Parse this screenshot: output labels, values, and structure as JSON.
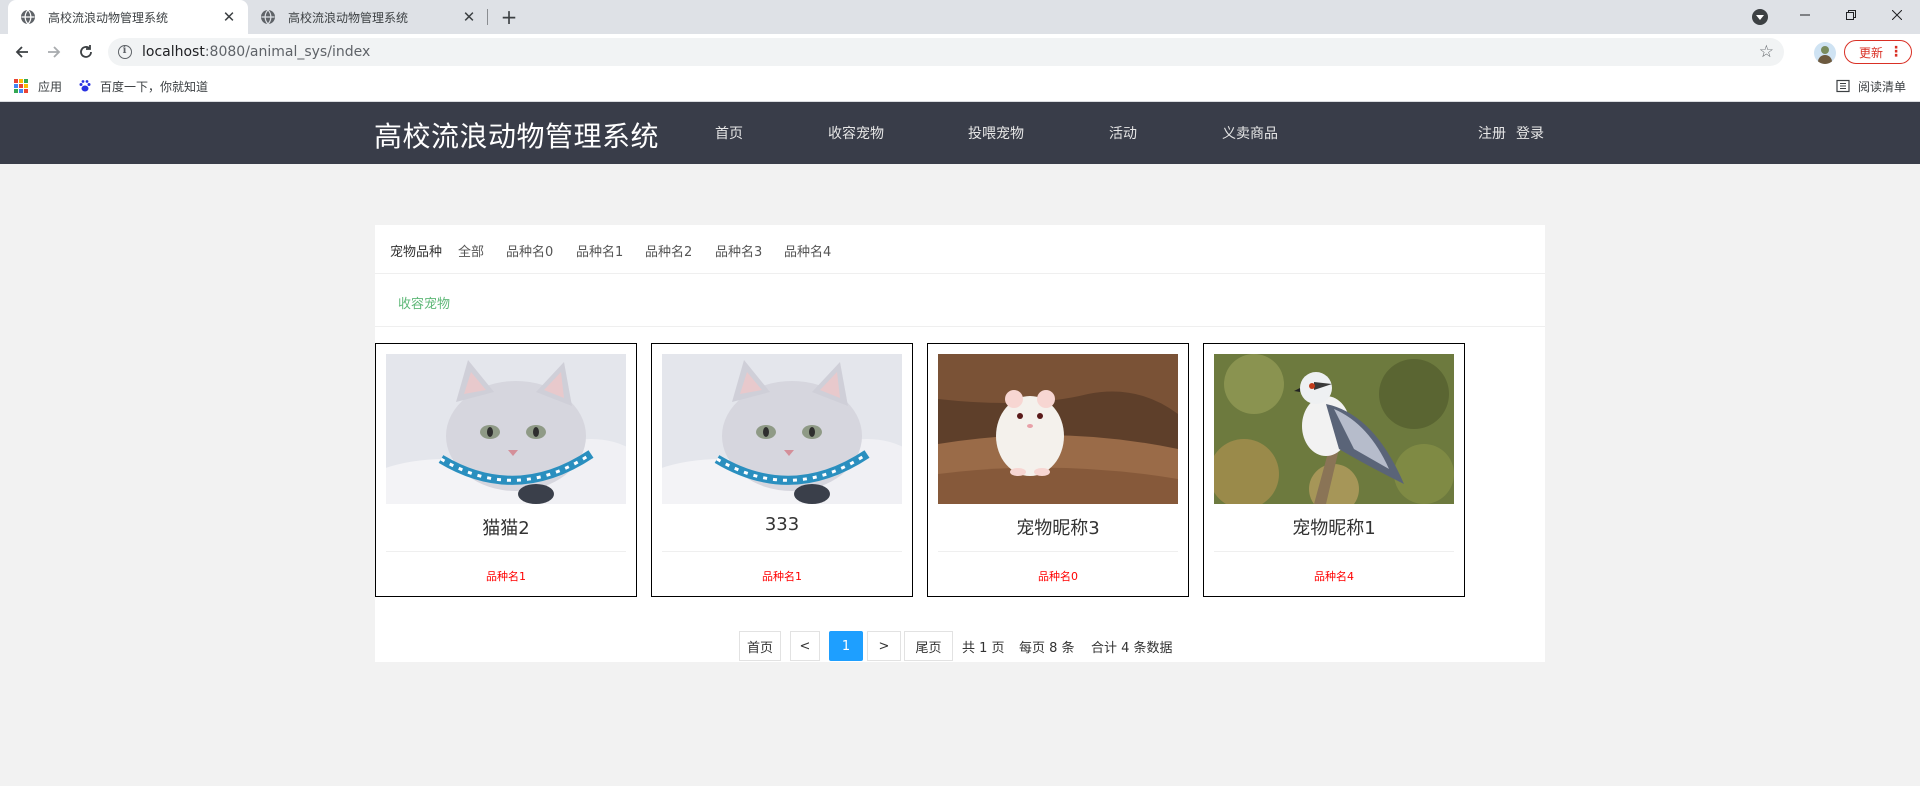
{
  "browser": {
    "tabs": [
      {
        "title": "高校流浪动物管理系统",
        "active": true
      },
      {
        "title": "高校流浪动物管理系统",
        "active": false
      }
    ],
    "close_glyph": "✕",
    "new_tab_glyph": "+",
    "address": {
      "host": "localhost",
      "path": ":8080/animal_sys/index"
    },
    "update_label": "更新",
    "bookmarks": {
      "apps": "应用",
      "baidu": "百度一下，你就知道",
      "reading_list": "阅读清单"
    }
  },
  "site": {
    "title": "高校流浪动物管理系统",
    "nav": [
      "首页",
      "收容宠物",
      "投喂宠物",
      "活动",
      "义卖商品"
    ],
    "auth": {
      "register": "注册",
      "login": "登录"
    }
  },
  "filter": {
    "label": "宠物品种",
    "options": [
      "全部",
      "品种名0",
      "品种名1",
      "品种名2",
      "品种名3",
      "品种名4"
    ]
  },
  "section_tab": "收容宠物",
  "pets": [
    {
      "name": "猫猫2",
      "breed": "品种名1",
      "image": "cat-photo"
    },
    {
      "name": "333",
      "breed": "品种名1",
      "image": "cat-photo"
    },
    {
      "name": "宠物昵称3",
      "breed": "品种名0",
      "image": "hamster-photo"
    },
    {
      "name": "宠物昵称1",
      "breed": "品种名4",
      "image": "bird-photo"
    }
  ],
  "pagination": {
    "first": "首页",
    "prev": "<",
    "current": "1",
    "next": ">",
    "last": "尾页",
    "total_pages": "共 1 页",
    "per_page": "每页 8 条",
    "total_records": "合计 4 条数据"
  },
  "colors": {
    "header_bg": "#393d49",
    "accent_green": "#5fb878",
    "active_page": "#1e9fff",
    "breed_red": "#ff0000"
  }
}
